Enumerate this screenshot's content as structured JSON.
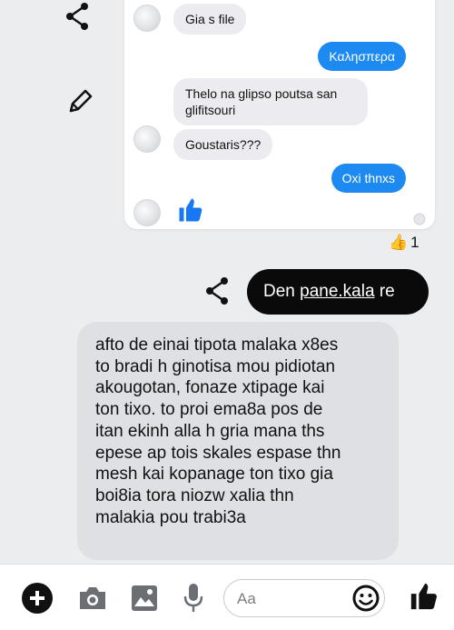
{
  "screenshot": {
    "messages": [
      {
        "side": "incoming",
        "text": "Gia s file"
      },
      {
        "side": "outgoing",
        "text": "Καλησπερα"
      },
      {
        "side": "incoming",
        "text": "Thelo na glipso poutsa san glifitsouri"
      },
      {
        "side": "incoming",
        "text": "Goustaris???"
      },
      {
        "side": "outgoing",
        "text": "Oxi thnxs"
      }
    ],
    "outgoing_color": "#1d8af2",
    "incoming_color": "#ececf0"
  },
  "reaction": {
    "emoji": "👍",
    "count": "1"
  },
  "reply": {
    "prefix": "Den ",
    "link": "pane.kala",
    "suffix": " re"
  },
  "message_lines": [
    "afto de einai tipota malaka x8es",
    "to bradi h ginotisa mou pidiotan",
    "akougotan, fonaze xtipage kai",
    "ton tixo. to proi ema8a pos de",
    "itan ekinh alla h gria mana ths",
    "epese ap tois skales espase thn",
    "mesh kai kopanage ton tixo gia",
    "boi8ia tora niozw xalia thn",
    "malakia pou trabi3a"
  ],
  "composer": {
    "placeholder": "Aa",
    "icons": [
      "plus-icon",
      "camera-icon",
      "image-icon",
      "microphone-icon",
      "emoji-icon",
      "like-icon"
    ]
  }
}
